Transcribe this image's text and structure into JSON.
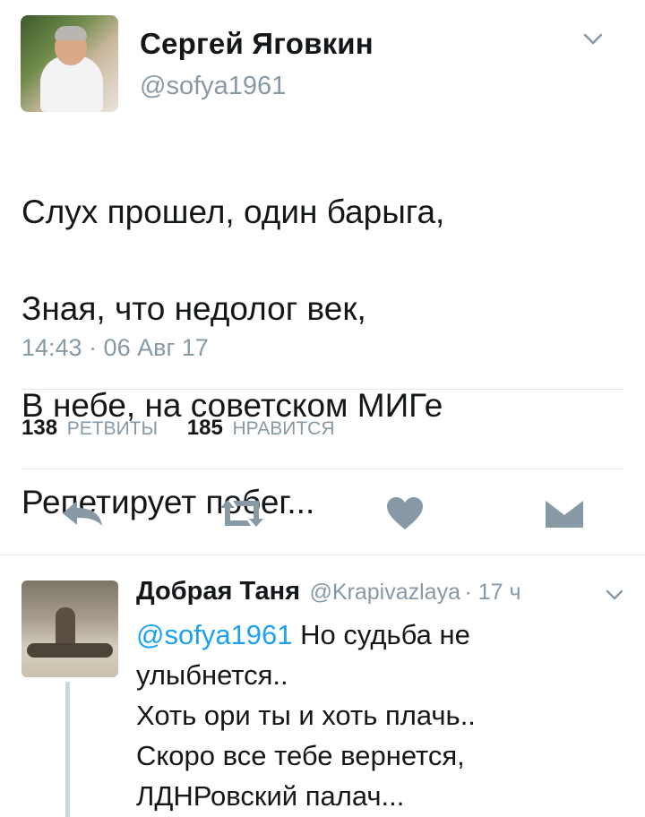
{
  "main_tweet": {
    "display_name": "Сергей Яговкин",
    "handle": "@sofya1961",
    "text_lines": [
      "Слух прошел, один барыга,",
      "Зная, что недолог век,",
      "В небе, на советском МИГе",
      "Репетирует побег..."
    ],
    "timestamp": "14:43 · 06 Авг 17",
    "stats": {
      "retweets_count": "138",
      "retweets_label": "РЕТВИТЫ",
      "likes_count": "185",
      "likes_label": "НРАВИТСЯ"
    },
    "actions": [
      "reply-icon",
      "retweet-icon",
      "heart-icon",
      "message-icon"
    ]
  },
  "reply_tweet": {
    "display_name": "Добрая Таня",
    "handle": "@Krapivazlaya",
    "time": "· 17 ч",
    "mention": "@sofya1961",
    "text_first": " Но судьба не",
    "text_lines": [
      "улыбнется..",
      "Хоть ори ты и хоть плачь..",
      "Скоро все тебе вернется,",
      "ЛДНРовский палач..."
    ]
  },
  "colors": {
    "text": "#14171a",
    "secondary": "#8899a6",
    "accent": "#1da1f2",
    "divider": "#e1e8ed",
    "icon": "#8899a6"
  }
}
